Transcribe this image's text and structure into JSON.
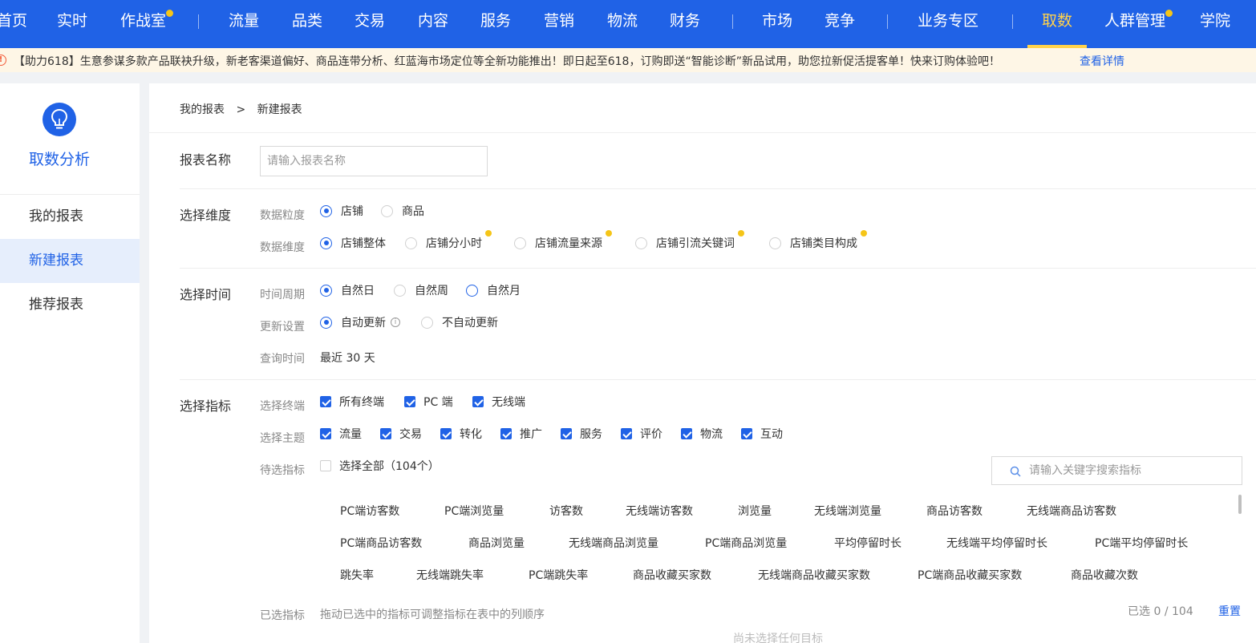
{
  "nav": {
    "items": [
      {
        "label": "首页",
        "dot": false,
        "active": false
      },
      {
        "label": "实时",
        "dot": false,
        "active": false
      },
      {
        "label": "作战室",
        "dot": true,
        "active": false
      },
      {
        "label": "流量",
        "dot": false,
        "active": false
      },
      {
        "label": "品类",
        "dot": false,
        "active": false
      },
      {
        "label": "交易",
        "dot": false,
        "active": false
      },
      {
        "label": "内容",
        "dot": false,
        "active": false
      },
      {
        "label": "服务",
        "dot": false,
        "active": false
      },
      {
        "label": "营销",
        "dot": false,
        "active": false
      },
      {
        "label": "物流",
        "dot": false,
        "active": false
      },
      {
        "label": "财务",
        "dot": false,
        "active": false
      },
      {
        "label": "市场",
        "dot": false,
        "active": false
      },
      {
        "label": "竞争",
        "dot": false,
        "active": false
      },
      {
        "label": "业务专区",
        "dot": false,
        "active": false
      },
      {
        "label": "取数",
        "dot": false,
        "active": true
      },
      {
        "label": "人群管理",
        "dot": true,
        "active": false
      },
      {
        "label": "学院",
        "dot": false,
        "active": false
      }
    ],
    "accent_color": "#2062e6",
    "active_color": "#ffd24c"
  },
  "notice": {
    "icon": "alert-circle-icon",
    "text": "【助力618】生意参谋多款产品联袂升级，新老客渠道偏好、商品连带分析、红蓝海市场定位等全新功能推出！即日起至618，订购即送“智能诊断”新品试用，助您拉新促活提客单！快来订购体验吧！",
    "link": "查看详情"
  },
  "sidebar": {
    "logo_icon": "lightbulb-icon",
    "title": "取数分析",
    "items": [
      {
        "label": "我的报表",
        "active": false
      },
      {
        "label": "新建报表",
        "active": true
      },
      {
        "label": "推荐报表",
        "active": false
      }
    ]
  },
  "breadcrumb": {
    "parent": "我的报表",
    "separator": ">",
    "current": "新建报表"
  },
  "report_name": {
    "label": "报表名称",
    "placeholder": "请输入报表名称",
    "value": ""
  },
  "dimension": {
    "label": "选择维度",
    "granularity": {
      "label": "数据粒度",
      "options": [
        {
          "label": "店铺",
          "selected": true
        },
        {
          "label": "商品",
          "selected": false
        }
      ]
    },
    "dims": {
      "label": "数据维度",
      "options": [
        {
          "label": "店铺整体",
          "selected": true,
          "dot": false
        },
        {
          "label": "店铺分小时",
          "selected": false,
          "dot": true
        },
        {
          "label": "店铺流量来源",
          "selected": false,
          "dot": true
        },
        {
          "label": "店铺引流关键词",
          "selected": false,
          "dot": true
        },
        {
          "label": "店铺类目构成",
          "selected": false,
          "dot": true
        }
      ]
    }
  },
  "time": {
    "label": "选择时间",
    "period": {
      "label": "时间周期",
      "options": [
        {
          "label": "自然日",
          "selected": true
        },
        {
          "label": "自然周",
          "selected": false
        },
        {
          "label": "自然月",
          "selected": false
        }
      ]
    },
    "update": {
      "label": "更新设置",
      "options": [
        {
          "label": "自动更新",
          "selected": true
        },
        {
          "label": "不自动更新",
          "selected": false
        }
      ],
      "info_icon": "info-icon"
    },
    "query": {
      "label": "查询时间",
      "value": "最近 30 天"
    }
  },
  "metrics": {
    "label": "选择指标",
    "terminal": {
      "label": "选择终端",
      "options": [
        {
          "label": "所有终端",
          "checked": true
        },
        {
          "label": "PC 端",
          "checked": true
        },
        {
          "label": "无线端",
          "checked": true
        }
      ]
    },
    "theme": {
      "label": "选择主题",
      "options": [
        {
          "label": "流量",
          "checked": true
        },
        {
          "label": "交易",
          "checked": true
        },
        {
          "label": "转化",
          "checked": true
        },
        {
          "label": "推广",
          "checked": true
        },
        {
          "label": "服务",
          "checked": true
        },
        {
          "label": "评价",
          "checked": true
        },
        {
          "label": "物流",
          "checked": true
        },
        {
          "label": "互动",
          "checked": true
        }
      ]
    },
    "candidates": {
      "label": "待选指标",
      "select_all": "选择全部（104个）",
      "search_placeholder": "请输入关键字搜索指标",
      "items": [
        "PC端访客数",
        "PC端浏览量",
        "访客数",
        "无线端访客数",
        "浏览量",
        "无线端浏览量",
        "商品访客数",
        "无线端商品访客数",
        "PC端商品访客数",
        "商品浏览量",
        "无线端商品浏览量",
        "PC端商品浏览量",
        "平均停留时长",
        "无线端平均停留时长",
        "PC端平均停留时长",
        "跳失率",
        "无线端跳失率",
        "PC端跳失率",
        "商品收藏买家数",
        "无线端商品收藏买家数",
        "PC端商品收藏买家数",
        "商品收藏次数"
      ]
    },
    "selected": {
      "label": "已选指标",
      "hint": "拖动已选中的指标可调整指标在表中的列顺序",
      "count_prefix": "已选",
      "count": "0",
      "count_sep": "/",
      "total": "104",
      "reset": "重置",
      "empty": "尚未选择任何目标"
    }
  }
}
